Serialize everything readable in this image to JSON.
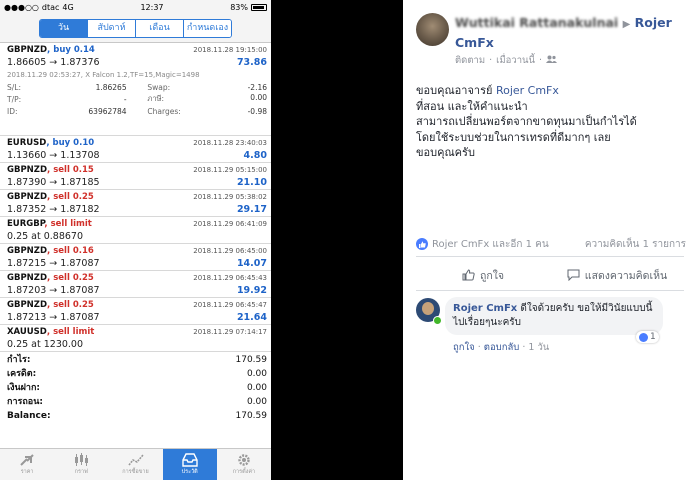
{
  "phone": {
    "status": {
      "carrier": "dtac",
      "network": "4G",
      "time": "12:37",
      "battery": "83%"
    },
    "segments": [
      "วัน",
      "สัปดาห์",
      "เดือน",
      "กำหนดเอง"
    ],
    "first_trade": {
      "symbol": "GBPNZD",
      "side": "buy 0.14",
      "datetime": "2018.11.28 19:15:00",
      "prices": "1.86605 → 1.87376",
      "profit": "73.86",
      "comment": "2018.11.29 02:53:27, X Falcon 1.2,TF=15,Magic=1498",
      "details": [
        {
          "k1": "S/L:",
          "v1": "1.86265",
          "k2": "Swap:",
          "v2": "-2.16"
        },
        {
          "k1": "T/P:",
          "v1": "-",
          "k2": "ภาษี:",
          "v2": "0.00"
        },
        {
          "k1": "ID:",
          "v1": "63962784",
          "k2": "Charges:",
          "v2": "-0.98"
        }
      ]
    },
    "trades": [
      {
        "symbol": "EURUSD",
        "side": "buy 0.10",
        "type": "buy",
        "datetime": "2018.11.28 23:40:03",
        "prices": "1.13660 → 1.13708",
        "profit": "4.80"
      },
      {
        "symbol": "GBPNZD",
        "side": "sell 0.15",
        "type": "sell",
        "datetime": "2018.11.29 05:15:00",
        "prices": "1.87390 → 1.87185",
        "profit": "21.10"
      },
      {
        "symbol": "GBPNZD",
        "side": "sell 0.25",
        "type": "sell",
        "datetime": "2018.11.29 05:38:02",
        "prices": "1.87352 → 1.87182",
        "profit": "29.17"
      },
      {
        "symbol": "EURGBP",
        "side": "sell limit",
        "type": "sell",
        "datetime": "2018.11.29 06:41:09",
        "prices": "0.25 at 0.88670",
        "profit": ""
      },
      {
        "symbol": "GBPNZD",
        "side": "sell 0.16",
        "type": "sell",
        "datetime": "2018.11.29 06:45:00",
        "prices": "1.87215 → 1.87087",
        "profit": "14.07"
      },
      {
        "symbol": "GBPNZD",
        "side": "sell 0.25",
        "type": "sell",
        "datetime": "2018.11.29 06:45:43",
        "prices": "1.87203 → 1.87087",
        "profit": "19.92"
      },
      {
        "symbol": "GBPNZD",
        "side": "sell 0.25",
        "type": "sell",
        "datetime": "2018.11.29 06:45:47",
        "prices": "1.87213 → 1.87087",
        "profit": "21.64"
      },
      {
        "symbol": "XAUUSD",
        "side": "sell limit",
        "type": "sell",
        "datetime": "2018.11.29 07:14:17",
        "prices": "0.25 at 1230.00",
        "profit": ""
      }
    ],
    "summary": [
      {
        "label": "กำไร:",
        "value": "170.59"
      },
      {
        "label": "เครดิต:",
        "value": "0.00"
      },
      {
        "label": "เงินฝาก:",
        "value": "0.00"
      },
      {
        "label": "การถอน:",
        "value": "0.00"
      },
      {
        "label": "Balance:",
        "value": "170.59"
      }
    ],
    "tabs": [
      "ราคา",
      "กราฟ",
      "การซื้อขาย",
      "ประวัติ",
      "การตั้งค่า"
    ]
  },
  "facebook": {
    "author_blurred": "Wuttikai Rattanakulnai",
    "author": "Rojer CmFx",
    "meta": {
      "follow": "ติดตาม",
      "time": "เมื่อวานนี้"
    },
    "post": {
      "line1_prefix": "ขอบคุณอาจารย์ ",
      "mention": "Rojer CmFx",
      "line2": "ที่สอน และให้คำแนะนำ",
      "line3": "สามารถเปลี่ยนพอร์ตจากขาดทุนมาเป็นกำไรได้",
      "line4": "โดยใช้ระบบช่วยในการเทรดที่ดีมากๆ เลย",
      "line5": "ขอบคุณครับ"
    },
    "reactions": {
      "likes": "Rojer CmFx และอีก 1 คน",
      "comments": "ความคิดเห็น 1 รายการ"
    },
    "actions": {
      "like": "ถูกใจ",
      "comment": "แสดงความคิดเห็น"
    },
    "comment": {
      "name": "Rojer CmFx",
      "text": "ดีใจด้วยครับ ขอให้มีวินัยแบบนี้ไปเรื่อยๆนะครับ",
      "likes": "1",
      "like": "ถูกใจ",
      "reply": "ตอบกลับ",
      "time": "1 วัน"
    }
  }
}
